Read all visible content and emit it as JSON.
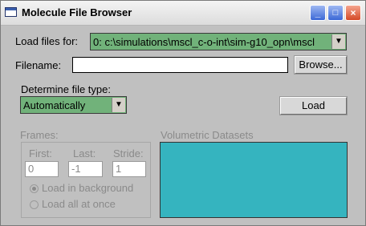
{
  "window": {
    "title": "Molecule File Browser",
    "minimize": "_",
    "maximize": "□",
    "close": "×"
  },
  "load_for": {
    "label": "Load files for:",
    "value": "0: c:\\simulations\\mscl_c-o-int\\sim-g10_opn\\mscl",
    "arrow": "▼"
  },
  "filename": {
    "label": "Filename:",
    "value": "",
    "browse_label": "Browse..."
  },
  "file_type": {
    "label": "Determine file type:",
    "value": "Automatically",
    "arrow": "▼"
  },
  "load_button": "Load",
  "frames": {
    "label": "Frames:",
    "first_label": "First:",
    "first_value": "0",
    "last_label": "Last:",
    "last_value": "-1",
    "stride_label": "Stride:",
    "stride_value": "1",
    "opt_background": "Load in background",
    "opt_all": "Load all at once"
  },
  "volumetric": {
    "label": "Volumetric Datasets"
  },
  "colors": {
    "selector_green": "#71b27a",
    "dataset_teal": "#35b4bf"
  },
  "icons": [
    "app-window-icon",
    "minimize-icon",
    "maximize-icon",
    "close-icon",
    "dropdown-arrow-icon"
  ]
}
